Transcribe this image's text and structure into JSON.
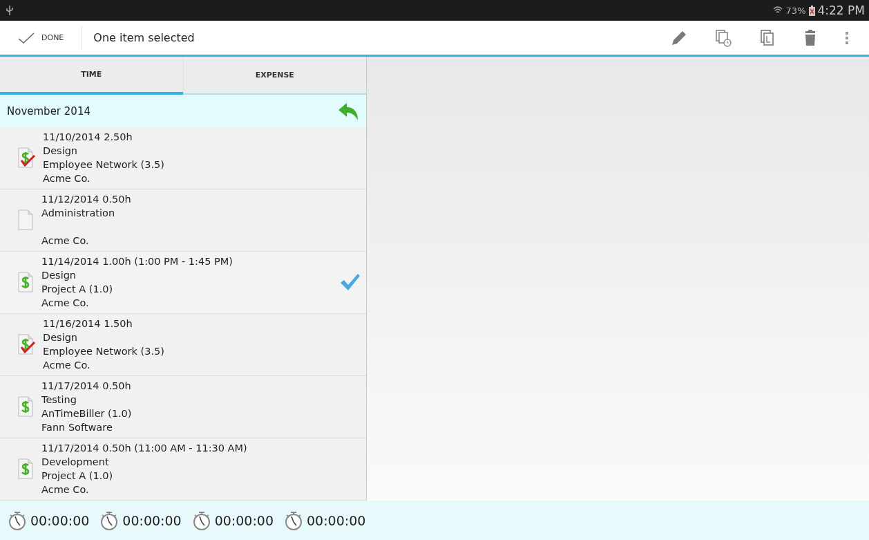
{
  "status_bar": {
    "battery": "73%",
    "time": "4:22 PM"
  },
  "action_bar": {
    "done_label": "DONE",
    "title": "One item selected",
    "actions": [
      {
        "kind": "edit"
      },
      {
        "kind": "copy_time"
      },
      {
        "kind": "copy"
      },
      {
        "kind": "delete"
      },
      {
        "kind": "overflow"
      }
    ]
  },
  "tabs": [
    {
      "label": "TIME",
      "selected": true
    },
    {
      "label": "EXPENSE",
      "selected": false
    }
  ],
  "month_header": {
    "label": "November 2014"
  },
  "entries": [
    {
      "kind": "billable_approved",
      "summary": "11/10/2014 2.50h",
      "task": "Design",
      "project": "Employee Network (3.5)",
      "client": "Acme Co.",
      "selected": false
    },
    {
      "kind": "blank",
      "summary": "11/12/2014 0.50h",
      "task": "Administration",
      "client": "Acme Co.",
      "selected": false
    },
    {
      "kind": "billable",
      "summary": "11/14/2014 1.00h (1:00 PM - 1:45 PM)",
      "task": "Design",
      "project": "Project A (1.0)",
      "client": "Acme Co.",
      "selected": true
    },
    {
      "kind": "billable_approved",
      "summary": "11/16/2014 1.50h",
      "task": "Design",
      "project": "Employee Network (3.5)",
      "client": "Acme Co.",
      "selected": false
    },
    {
      "kind": "billable",
      "summary": "11/17/2014 0.50h",
      "task": "Testing",
      "project": "AnTimeBiller (1.0)",
      "client": "Fann Software",
      "selected": false
    },
    {
      "kind": "billable",
      "summary": "11/17/2014 0.50h (11:00 AM - 11:30 AM)",
      "task": "Development",
      "project": "Project A (1.0)",
      "client": "Acme Co.",
      "selected": false
    }
  ],
  "timers": [
    "00:00:00",
    "00:00:00",
    "00:00:00",
    "00:00:00"
  ]
}
